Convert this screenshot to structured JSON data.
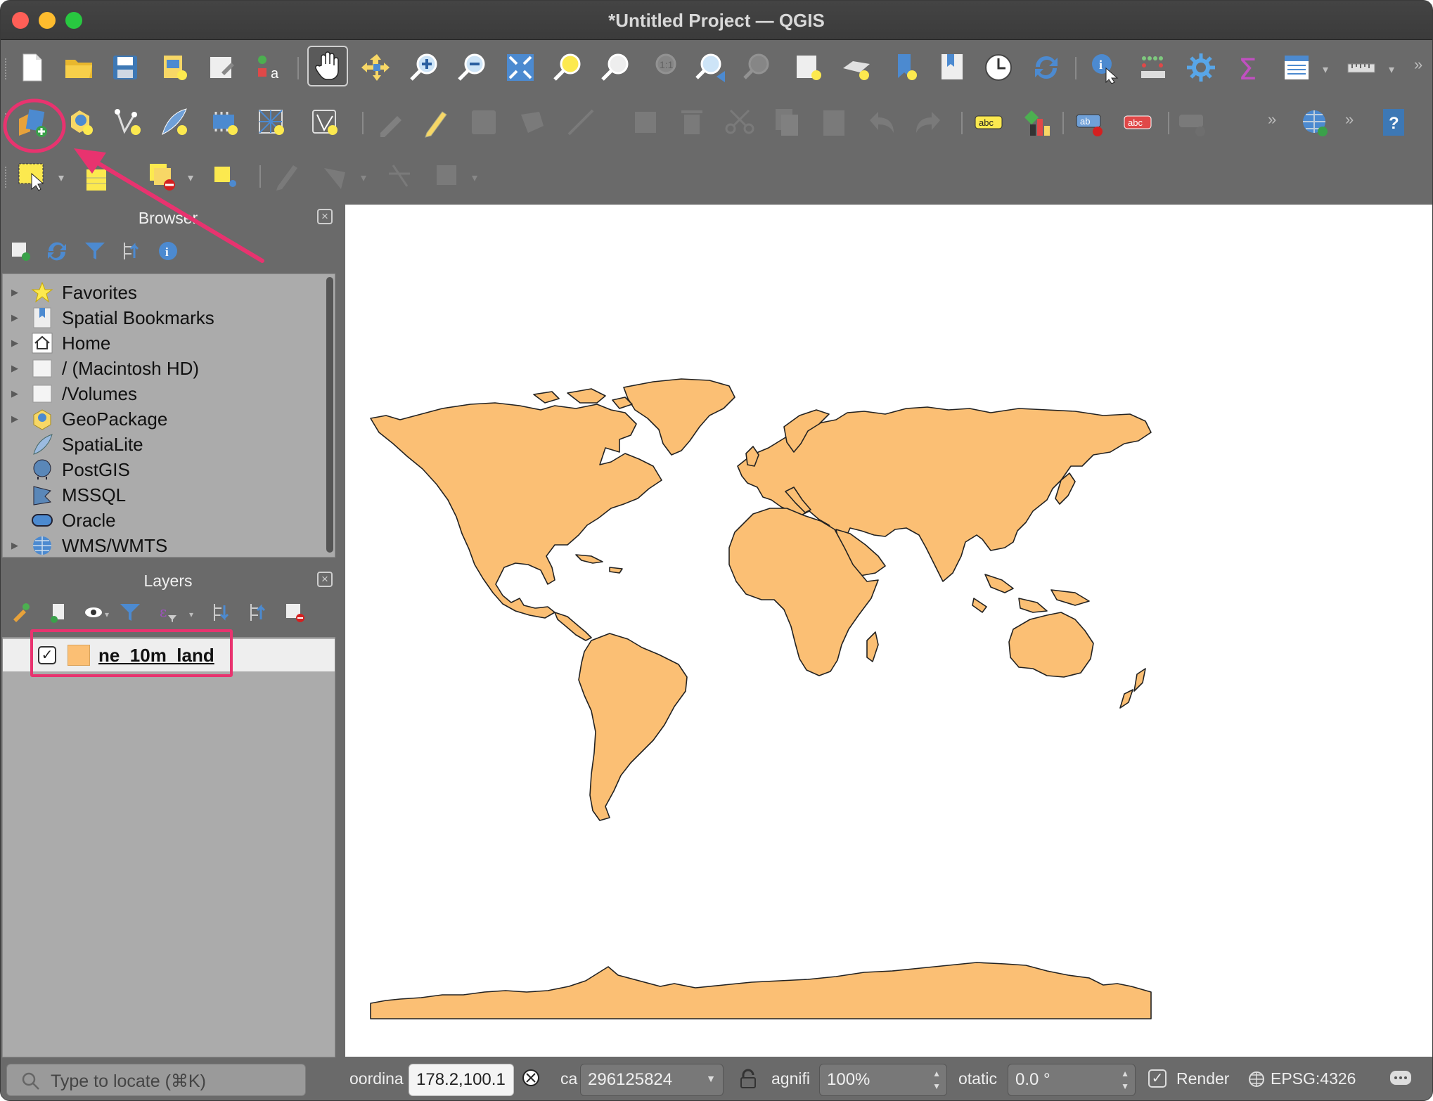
{
  "window": {
    "title": "*Untitled Project — QGIS"
  },
  "toolbar_icons": [
    "new-project-icon",
    "open-project-icon",
    "save-project-icon",
    "new-print-layout-icon",
    "layout-manager-icon",
    "style-manager-icon",
    "pan-icon",
    "pan-to-selection-icon",
    "zoom-in-icon",
    "zoom-out-icon",
    "zoom-full-icon",
    "zoom-to-selection-icon",
    "zoom-to-layer-icon",
    "zoom-native-icon",
    "zoom-last-icon",
    "zoom-next-icon",
    "new-map-view-icon",
    "new-3d-map-view-icon",
    "new-bookmark-icon",
    "show-bookmarks-icon",
    "temporal-controller-icon",
    "refresh-icon",
    "identify-icon",
    "attribute-table-icon",
    "processing-toolbox-icon",
    "statistics-icon",
    "open-field-calculator-icon",
    "measure-icon"
  ],
  "panels": {
    "browser": {
      "title": "Browser",
      "items": [
        {
          "label": "Favorites",
          "icon": "star-icon",
          "expandable": true
        },
        {
          "label": "Spatial Bookmarks",
          "icon": "bookmark-icon",
          "expandable": true
        },
        {
          "label": "Home",
          "icon": "home-icon",
          "expandable": true
        },
        {
          "label": "/ (Macintosh HD)",
          "icon": "folder-icon",
          "expandable": true
        },
        {
          "label": "/Volumes",
          "icon": "folder-icon",
          "expandable": true
        },
        {
          "label": "GeoPackage",
          "icon": "geopackage-icon",
          "expandable": true
        },
        {
          "label": "SpatiaLite",
          "icon": "spatialite-icon",
          "expandable": false
        },
        {
          "label": "PostGIS",
          "icon": "postgis-icon",
          "expandable": false
        },
        {
          "label": "MSSQL",
          "icon": "mssql-icon",
          "expandable": false
        },
        {
          "label": "Oracle",
          "icon": "oracle-icon",
          "expandable": false
        },
        {
          "label": "WMS/WMTS",
          "icon": "globe-icon",
          "expandable": true
        }
      ]
    },
    "layers": {
      "title": "Layers",
      "items": [
        {
          "name": "ne_10m_land",
          "checked": true,
          "fill_color": "#fbbf74"
        }
      ]
    }
  },
  "map": {
    "land_color": "#fbbf74",
    "background": "#ffffff"
  },
  "annotations": {
    "color": "#e8336f"
  },
  "status": {
    "locator_placeholder": "Type to locate (⌘K)",
    "coordinate_label": "oordina",
    "coordinate_value": "178.2,100.1",
    "scale_label": "ca",
    "scale_value": "296125824",
    "magnifier_label": "agnifi",
    "magnifier_value": "100%",
    "rotation_label": "otatic",
    "rotation_value": "0.0 °",
    "render_label": "Render",
    "render_checked": true,
    "crs": "EPSG:4326"
  }
}
